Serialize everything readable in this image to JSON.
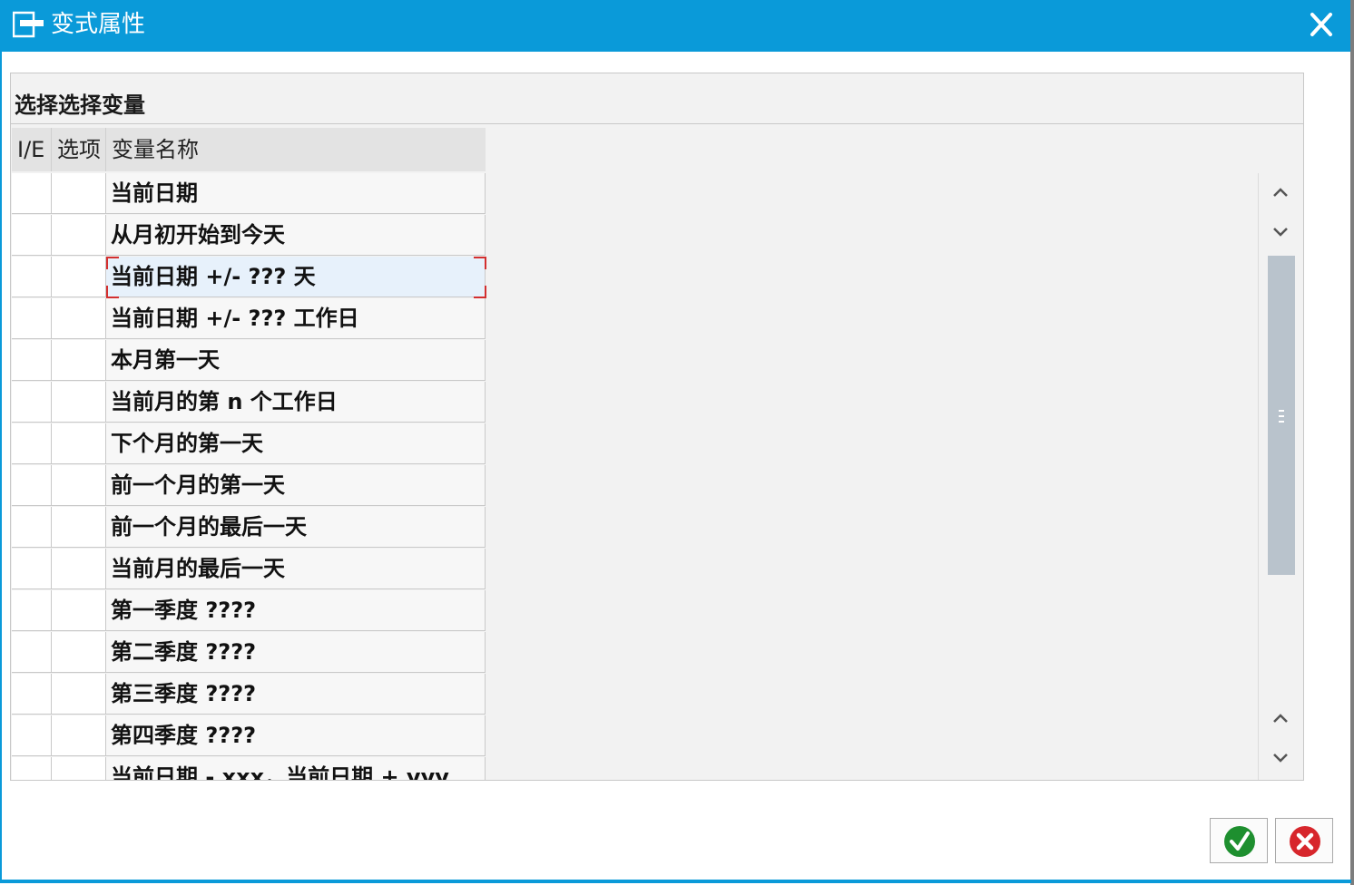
{
  "window": {
    "title": "变式属性",
    "title_icon": "window-icon",
    "close_icon": "close-icon",
    "accent_color": "#0a9ad9"
  },
  "section": {
    "title": "选择选择变量"
  },
  "columns": [
    {
      "label": "I/E"
    },
    {
      "label": "选项"
    },
    {
      "label": "变量名称"
    }
  ],
  "rows": [
    {
      "name": "当前日期"
    },
    {
      "name": "从月初开始到今天"
    },
    {
      "name": "当前日期 +/- ??? 天",
      "selected": true
    },
    {
      "name": "当前日期 +/- ??? 工作日"
    },
    {
      "name": "本月第一天"
    },
    {
      "name": "当前月的第 n 个工作日"
    },
    {
      "name": "下个月的第一天"
    },
    {
      "name": "前一个月的第一天"
    },
    {
      "name": "前一个月的最后一天"
    },
    {
      "name": "当前月的最后一天"
    },
    {
      "name": "第一季度 ????"
    },
    {
      "name": "第二季度 ????"
    },
    {
      "name": "第三季度 ????"
    },
    {
      "name": "第四季度 ????"
    },
    {
      "name": "当前日期 - xxx，当前日期 + yyy"
    }
  ],
  "scrollbar": {
    "icons": [
      "chevron-up-icon",
      "chevron-down-icon",
      "chevron-up-icon",
      "chevron-down-icon"
    ]
  },
  "buttons": {
    "ok_icon": "check-icon",
    "cancel_icon": "cancel-icon",
    "ok_color": "#1e8f2f",
    "cancel_color": "#d7262c"
  }
}
